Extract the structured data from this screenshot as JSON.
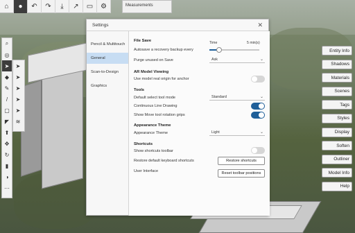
{
  "toolbar": {
    "measurements_label": "Measurements"
  },
  "right_panel": {
    "buttons": [
      "Entity Info",
      "Shadows",
      "Materials",
      "Scenes",
      "Tags",
      "Styles",
      "Display",
      "Soften",
      "Outliner",
      "Model Info",
      "Help"
    ]
  },
  "settings": {
    "title": "Settings",
    "nav": [
      "Pencil & Multitouch",
      "General",
      "Scan-to-Design",
      "Graphics"
    ],
    "selected_nav": "General",
    "file_save": {
      "heading": "File Save",
      "autosave_label": "Autosave a recovery backup every",
      "time_label": "Time",
      "time_value": "5 min(s)",
      "time_fraction": 0.2,
      "purge_label": "Purge unused on Save",
      "purge_value": "Ask"
    },
    "ar": {
      "heading": "AR Model Viewing",
      "origin_label": "Use model real origin for anchor",
      "origin_on": false
    },
    "tools": {
      "heading": "Tools",
      "select_mode_label": "Default select tool mode",
      "select_mode_value": "Standard",
      "continuous_label": "Continuous Line Drawing",
      "continuous_on": true,
      "move_grips_label": "Show Move tool rotation grips",
      "move_grips_on": true
    },
    "appearance": {
      "heading": "Appearance Theme",
      "theme_label": "Appearance Theme",
      "theme_value": "Light"
    },
    "shortcuts": {
      "heading": "Shortcuts",
      "show_toolbar_label": "Show shortcuts toolbar",
      "show_toolbar_on": false,
      "restore_label": "Restore default keyboard shortcuts",
      "restore_button": "Restore shortcuts"
    },
    "ui": {
      "heading": "User Interface",
      "reset_button": "Reset toolbar positions"
    }
  },
  "colors": {
    "accent": "#1f5f99",
    "nav_selected": "#c7ddf3"
  }
}
